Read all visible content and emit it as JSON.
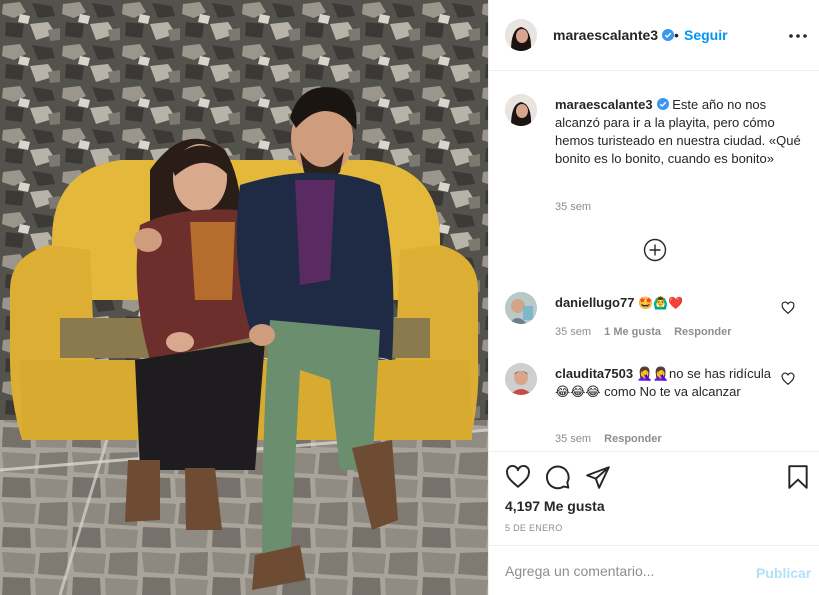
{
  "post": {
    "image_alt": "Pareja sentada en una banca amarilla de piedra",
    "author": "maraescalante3",
    "verified": true,
    "separator": "•",
    "follow_label": "Seguir",
    "more_icon": "more-options-icon",
    "caption": "Este año no nos alcanzó para ir a la playita, pero cómo hemos turisteado en nuestra ciudad. «Qué bonito es lo bonito, cuando es bonito»",
    "caption_time": "35 sem",
    "load_more_icon": "plus-circle-icon"
  },
  "comments": [
    {
      "username": "daniellugo77",
      "text": "🤩🙆‍♂️❤️",
      "time": "35 sem",
      "likes": "1 Me gusta",
      "reply": "Responder"
    },
    {
      "username": "claudita7503",
      "text": "🤦‍♀️🤦‍♀️no se has ridícula😂😂😂 como No te va alcanzar",
      "time": "35 sem",
      "reply": "Responder"
    }
  ],
  "actions": {
    "like_icon": "heart-icon",
    "comment_icon": "comment-icon",
    "share_icon": "paper-plane-icon",
    "save_icon": "bookmark-icon",
    "likes_count": "4,197 Me gusta",
    "date": "5 DE ENERO"
  },
  "composer": {
    "placeholder": "Agrega un comentario...",
    "publish_label": "Publicar"
  },
  "colors": {
    "accent": "#0095f6",
    "publish_disabled": "#b2dffc",
    "text": "#262626",
    "muted": "#8e8e8e",
    "heart_red": "#ed4956"
  }
}
